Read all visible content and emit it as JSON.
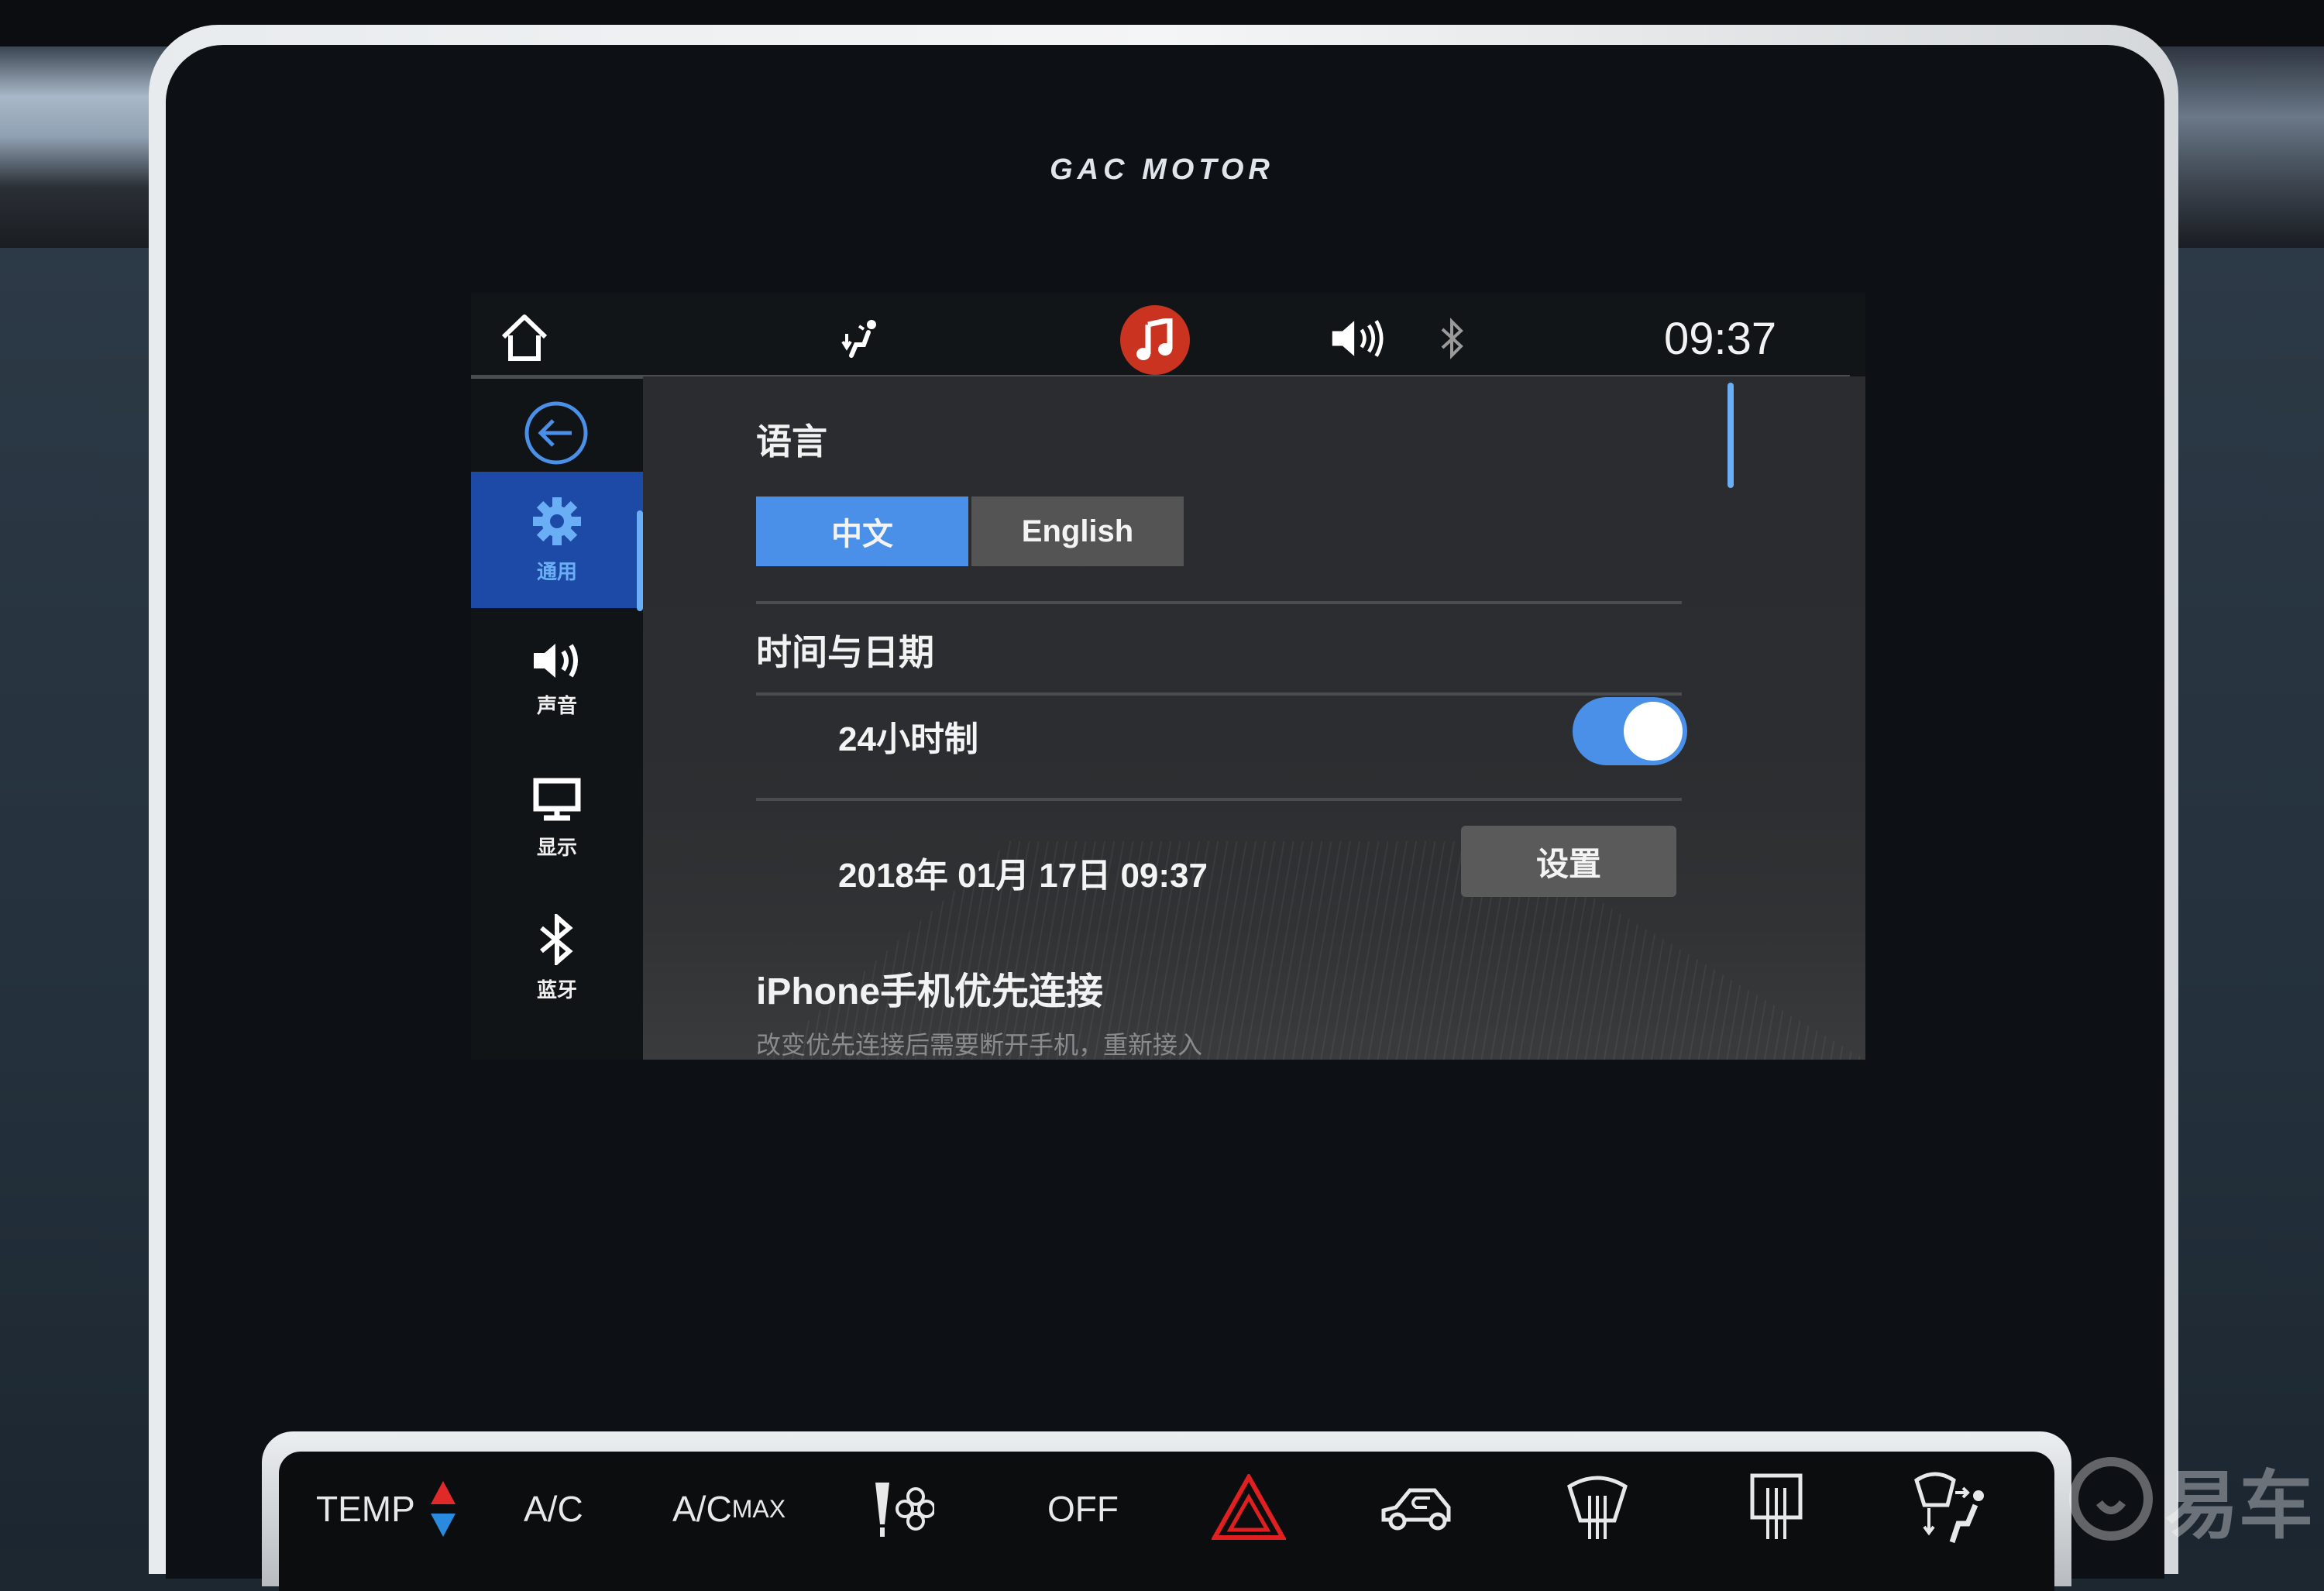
{
  "brand": "GAC MOTOR",
  "top_bar": {
    "icons": [
      "home-icon",
      "seat-airflow-icon",
      "music-icon",
      "volume-icon",
      "bluetooth-icon"
    ],
    "music_color": "#c9331f",
    "clock": "09:37"
  },
  "sidebar": {
    "back_icon": "back-arrow-icon",
    "items": [
      {
        "label": "通用",
        "icon": "gear-icon",
        "active": true
      },
      {
        "label": "声音",
        "icon": "speaker-icon",
        "active": false
      },
      {
        "label": "显示",
        "icon": "monitor-icon",
        "active": false
      },
      {
        "label": "蓝牙",
        "icon": "bluetooth-icon",
        "active": false
      }
    ],
    "active_color": "#1d4aa6",
    "accent_color": "#6aaef5"
  },
  "content": {
    "language": {
      "title": "语言",
      "options": [
        "中文",
        "English"
      ],
      "selected": "中文"
    },
    "time_date": {
      "title": "时间与日期",
      "format_24h_label": "24小时制",
      "format_24h_on": true,
      "datetime": "2018年 01月 17日  09:37",
      "set_button": "设置"
    },
    "iphone": {
      "title": "iPhone手机优先连接",
      "description": "改变优先连接后需要断开手机，重新接入"
    },
    "accent_color": "#4a90e8"
  },
  "climate_bar": {
    "temp_label": "TEMP",
    "ac_label": "A/C",
    "ac_max_label": "A/C",
    "ac_max_suffix": "MAX",
    "off_label": "OFF",
    "icons": [
      "temp-up-down-icon",
      "fan-speed-icon",
      "hazard-icon",
      "recirculation-icon",
      "front-defrost-icon",
      "rear-defrost-icon",
      "windshield-airflow-icon"
    ],
    "hazard_color": "#e02020"
  },
  "watermark": "易车"
}
